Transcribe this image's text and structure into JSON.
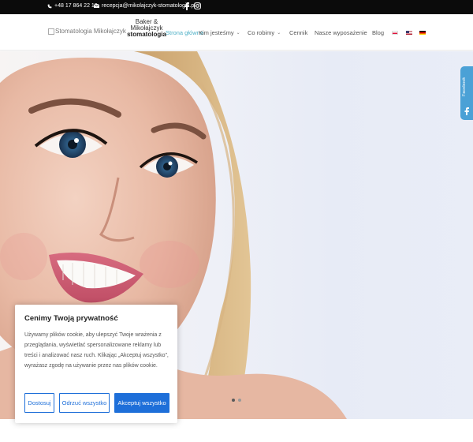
{
  "topbar": {
    "phone": "+48 17 864 22 19",
    "email": "recepcja@mikolajczyk-stomatologia.pl",
    "icons": [
      "phone-icon",
      "mail-icon",
      "facebook-icon",
      "instagram-icon"
    ]
  },
  "header": {
    "logo_alt": "Stomatologia Mikołajczyk",
    "brand_line1": "Baker &",
    "brand_line2": "Mikołajczyk",
    "brand_line3": "stomatologia",
    "nav": [
      {
        "label": "Strona główna",
        "has_dropdown": false
      },
      {
        "label": "Kim jesteśmy",
        "has_dropdown": true
      },
      {
        "label": "Co robimy",
        "has_dropdown": true
      },
      {
        "label": "Cennik",
        "has_dropdown": false
      },
      {
        "label": "Nasze wyposażenie",
        "has_dropdown": false
      },
      {
        "label": "Blog",
        "has_dropdown": false
      }
    ],
    "languages": [
      "pl-flag-icon",
      "en-flag-icon",
      "de-flag-icon"
    ]
  },
  "side_tab": {
    "label": "Facebook"
  },
  "cookie": {
    "title": "Cenimy Twoją prywatność",
    "body": "Używamy plików cookie, aby ulepszyć Twoje wrażenia z przeglądania, wyświetlać spersonalizowane reklamy lub treści i analizować nasz ruch. Klikając „Akceptuj wszystko”, wyrażasz zgodę na używanie przez nas plików cookie.",
    "customize_label": "Dostosuj",
    "reject_label": "Odrzuć wszystko",
    "accept_label": "Akceptuj wszystko"
  },
  "colors": {
    "accent": "#1e6fd9",
    "nav_active": "#4fb0c6",
    "topbar_bg": "#0b0b0b",
    "side_tab": "#4ba1d6"
  }
}
